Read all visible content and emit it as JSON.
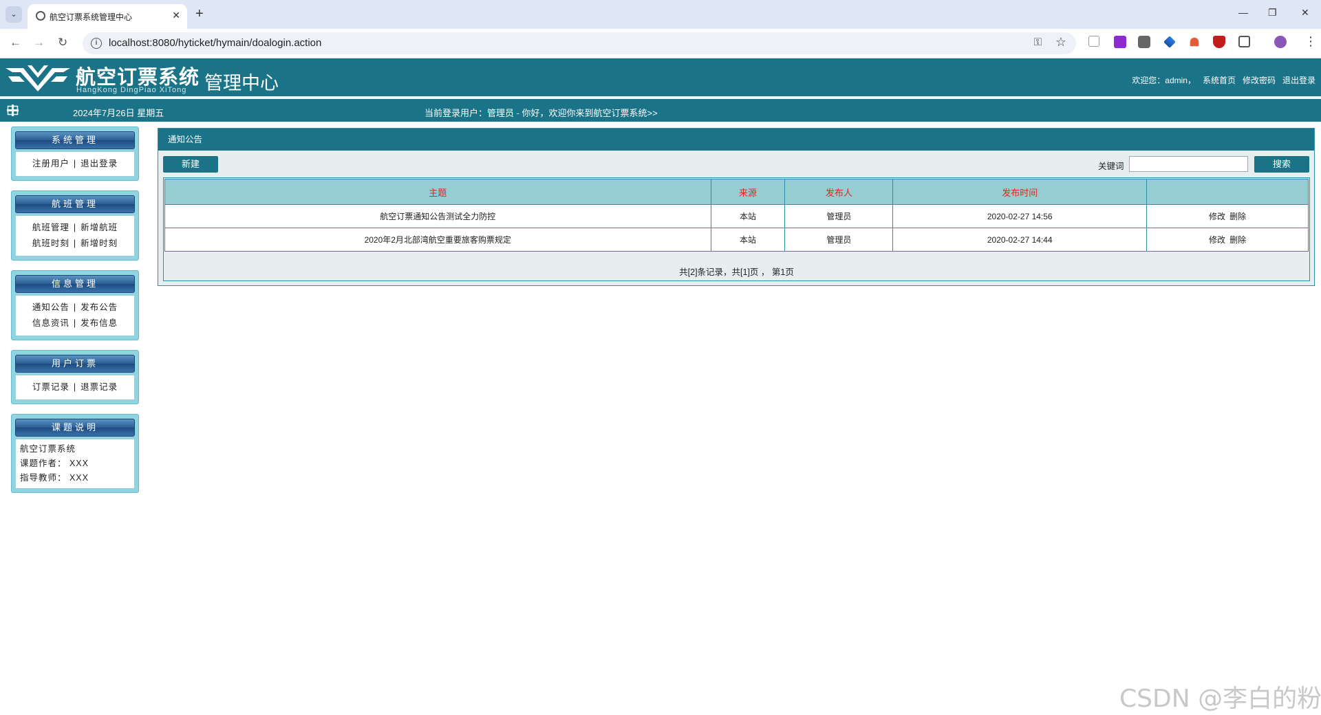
{
  "browser": {
    "tab_title": "航空订票系统管理中心",
    "url": "localhost:8080/hyticket/hymain/doalogin.action",
    "tab_close": "✕",
    "new_tab": "+",
    "tab_list": "⌄",
    "minimize": "—",
    "restore": "❐",
    "close": "✕",
    "back": "←",
    "forward": "→",
    "reload": "↻",
    "info": "i",
    "key": "⚿",
    "star": "☆",
    "menu": "⋮"
  },
  "header": {
    "logo_title": "航空订票系统",
    "logo_subtitle": "HangKong DingPiao XiTong",
    "logo_center": "管理中心",
    "welcome": "欢迎您：admin，",
    "links": [
      "系统首页",
      "修改密码",
      "退出登录"
    ]
  },
  "infobar": {
    "date": "2024年7月26日 星期五",
    "user_msg": "当前登录用户：管理员 - 你好，欢迎你来到航空订票系统>>"
  },
  "sidebar": {
    "sections": [
      {
        "title": "系统管理",
        "rows": [
          [
            "注册用户",
            "退出登录"
          ]
        ]
      },
      {
        "title": "航班管理",
        "rows": [
          [
            "航班管理",
            "新增航班"
          ],
          [
            "航班时刻",
            "新增时刻"
          ]
        ]
      },
      {
        "title": "信息管理",
        "rows": [
          [
            "通知公告",
            "发布公告"
          ],
          [
            "信息资讯",
            "发布信息"
          ]
        ]
      },
      {
        "title": "用户订票",
        "rows": [
          [
            "订票记录",
            "退票记录"
          ]
        ]
      }
    ],
    "note": {
      "title": "课题说明",
      "lines": [
        "航空订票系统",
        "课题作者： XXX",
        "指导教师： XXX"
      ]
    },
    "separator": "|"
  },
  "main": {
    "panel_title": "通知公告",
    "new_button": "新建",
    "keyword_label": "关键词",
    "keyword_value": "",
    "search_button": "搜索",
    "columns": [
      "主题",
      "来源",
      "发布人",
      "发布时间",
      ""
    ],
    "rows": [
      {
        "subject": "航空订票通知公告测试全力防控",
        "source": "本站",
        "publisher": "管理员",
        "time": "2020-02-27 14:56",
        "edit": "修改",
        "delete": "删除"
      },
      {
        "subject": "2020年2月北部湾航空重要旅客购票规定",
        "source": "本站",
        "publisher": "管理员",
        "time": "2020-02-27 14:44",
        "edit": "修改",
        "delete": "删除"
      }
    ],
    "pagination": "共[2]条记录，共[1]页 ， 第1页"
  },
  "watermark": "CSDN @李白的粉",
  "colors": {
    "header_bg": "#1b7388",
    "table_header_bg": "#96cdd2",
    "table_header_text": "#e0261b",
    "sidebar_bg": "#8fd4e0"
  },
  "icons": {
    "menu": "grid-icon",
    "ext": [
      "cursor-icon",
      "purple-ext-icon",
      "glasses-icon",
      "layers-icon",
      "tree-icon",
      "shield-icon",
      "puzzle-icon",
      "profile-icon"
    ]
  }
}
